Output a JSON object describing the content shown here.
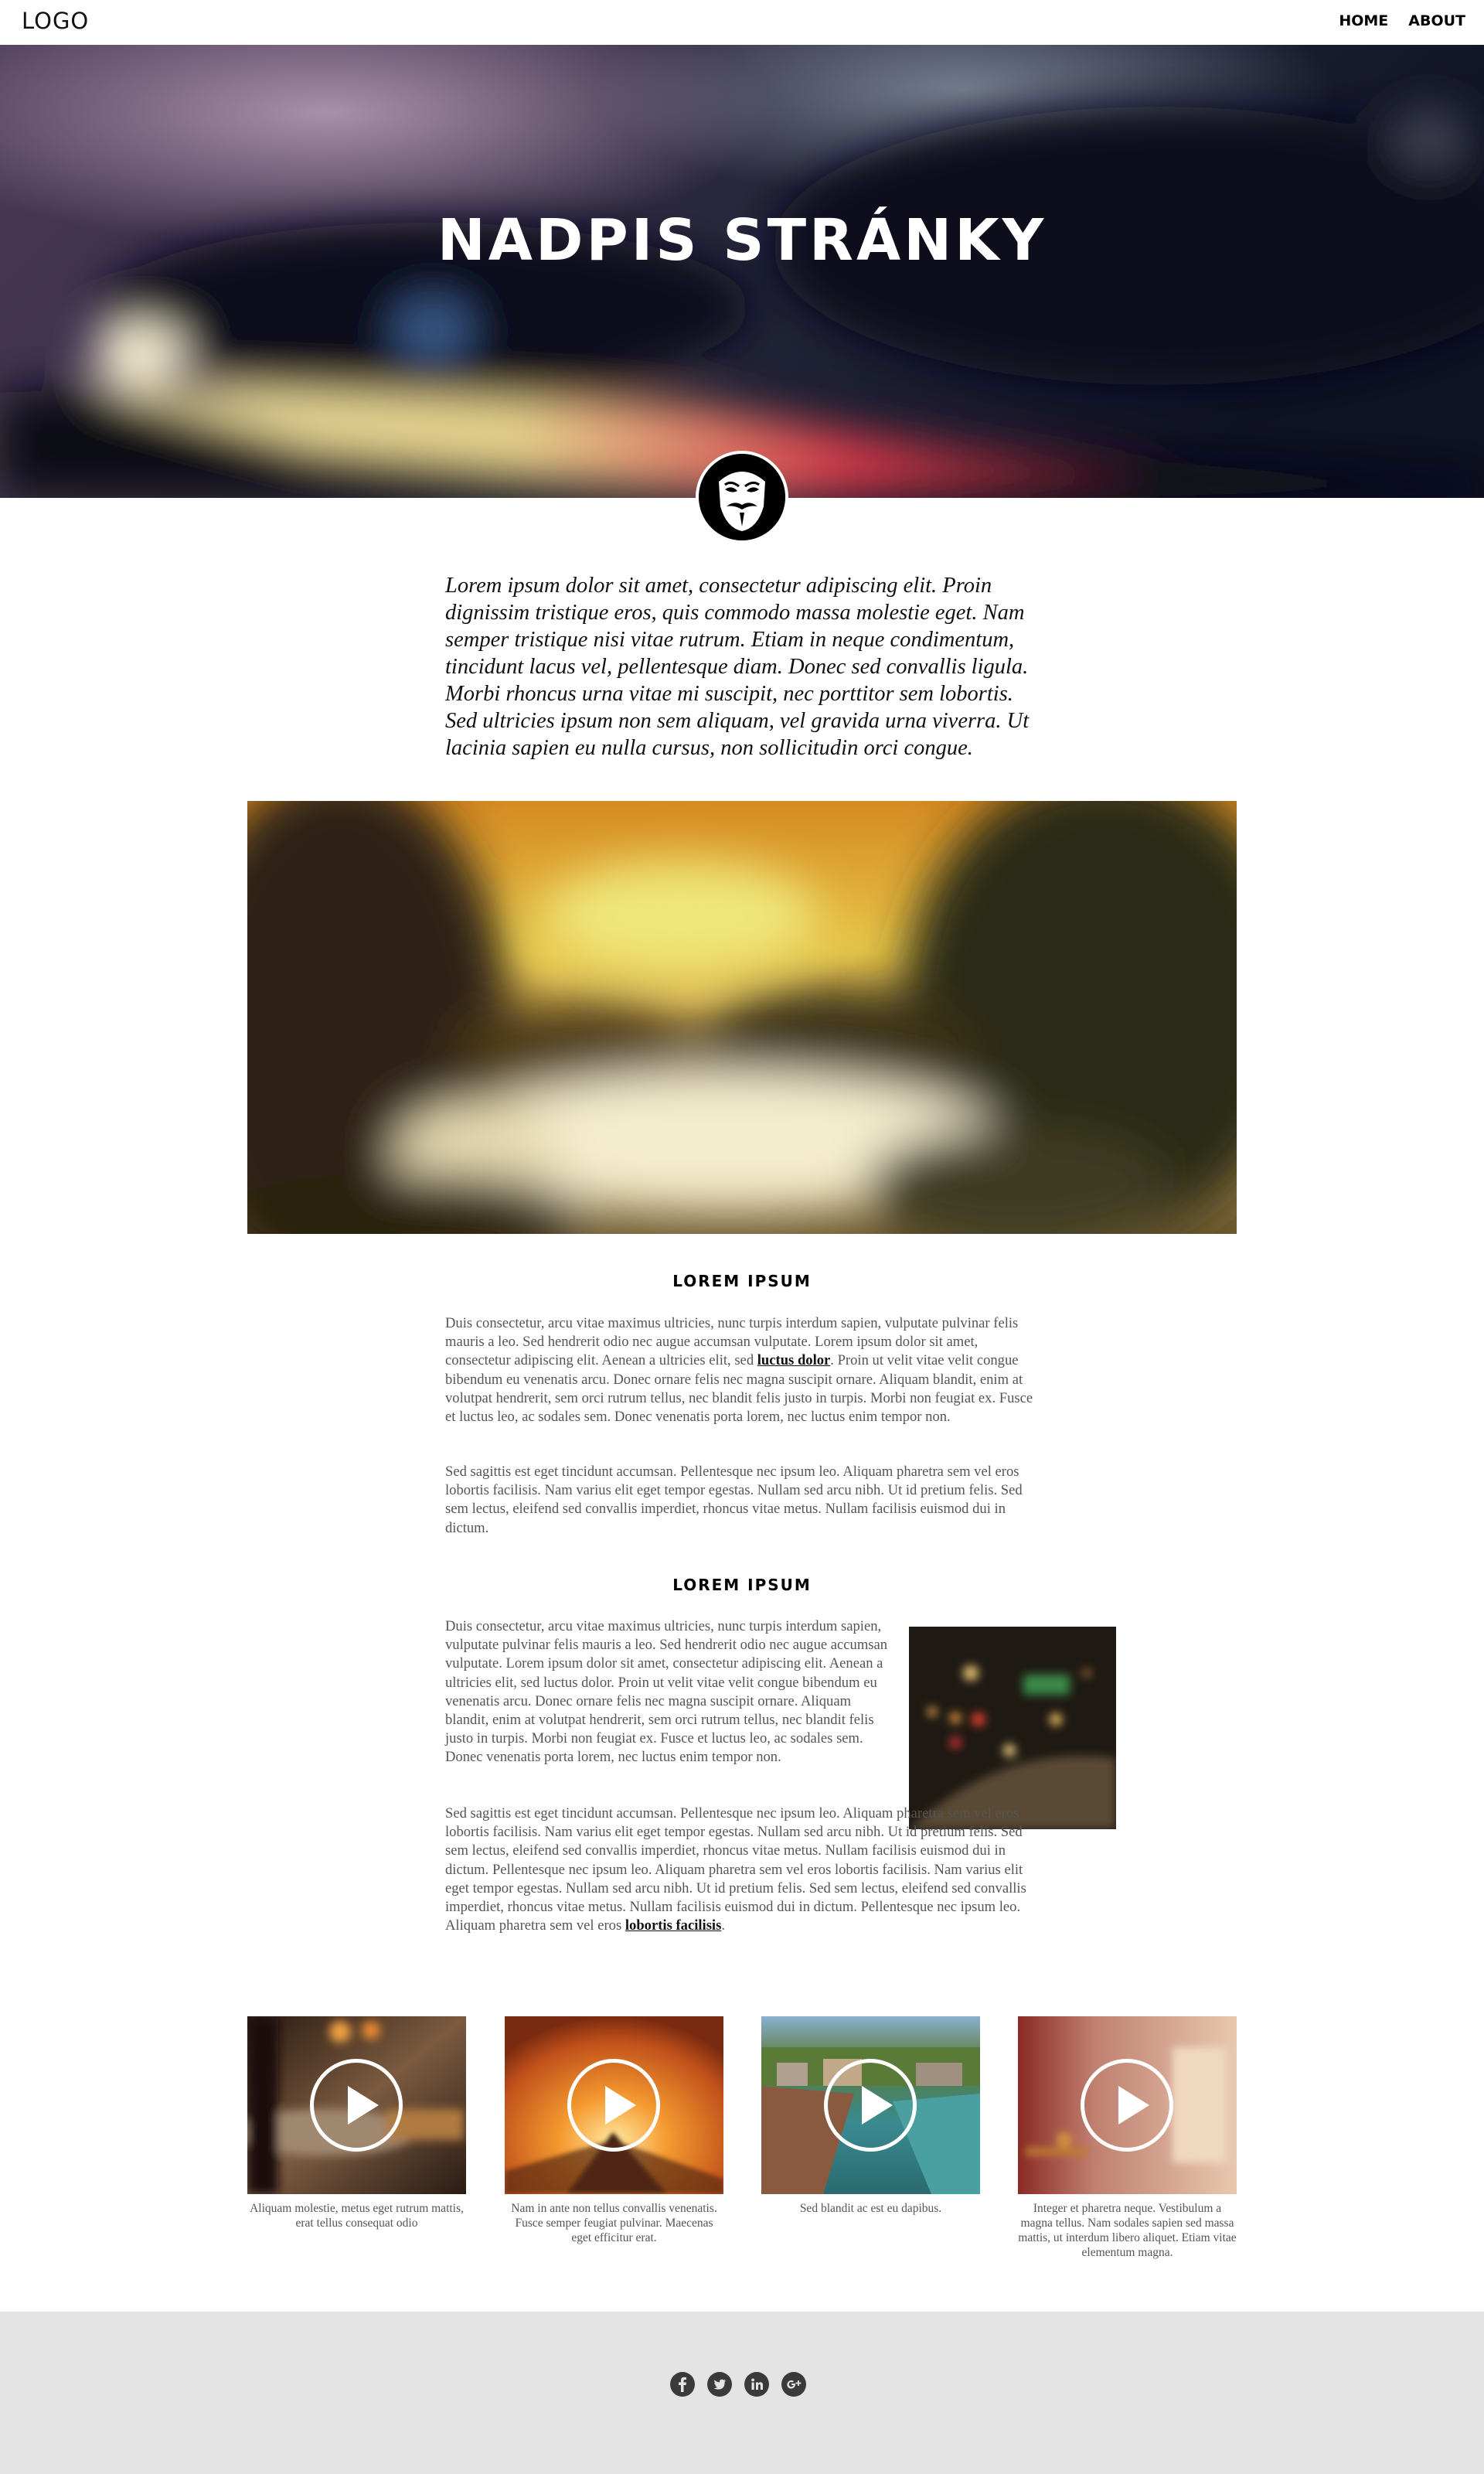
{
  "header": {
    "logo": "LOGO",
    "nav": [
      {
        "label": "HOME"
      },
      {
        "label": "ABOUT"
      }
    ]
  },
  "hero": {
    "title": "NADPIS STRÁNKY"
  },
  "intro": {
    "text": "Lorem ipsum dolor sit amet, consectetur adipiscing elit. Proin dignissim tristique eros, quis commodo massa molestie eget. Nam semper tristique nisi vitae rutrum. Etiam in neque condimentum, tincidunt lacus vel, pellentesque diam. Donec sed convallis ligula. Morbi rhoncus urna vitae mi suscipit, nec porttitor sem lobortis. Sed ultricies ipsum non sem aliquam, vel gravida urna viverra. Ut lacinia sapien eu nulla cursus, non sollicitudin orci congue."
  },
  "section1": {
    "title": "LOREM IPSUM",
    "p1_before": "Duis consectetur, arcu vitae maximus ultricies, nunc turpis interdum sapien, vulputate pulvinar felis mauris a leo. Sed hendrerit odio nec augue accumsan vulputate. Lorem ipsum dolor sit amet, consectetur adipiscing elit. Aenean a ultricies elit, sed ",
    "p1_link": "luctus dolor",
    "p1_after": ". Proin ut velit vitae velit congue bibendum eu venenatis arcu. Donec ornare felis nec magna suscipit ornare. Aliquam blandit, enim at volutpat hendrerit, sem orci rutrum tellus, nec blandit felis justo in turpis. Morbi non feugiat ex. Fusce et luctus leo, ac sodales sem. Donec venenatis porta lorem, nec luctus enim tempor non.",
    "p2": "Sed sagittis est eget tincidunt accumsan. Pellentesque nec ipsum leo. Aliquam pharetra sem vel eros lobortis facilisis. Nam varius elit eget tempor egestas. Nullam sed arcu nibh. Ut id pretium felis. Sed sem lectus, eleifend sed convallis imperdiet, rhoncus vitae metus. Nullam facilisis euismod dui in dictum."
  },
  "section2": {
    "title": "LOREM IPSUM",
    "p1": "Duis consectetur, arcu vitae maximus ultricies, nunc turpis interdum sapien, vulputate pulvinar felis mauris a leo. Sed hendrerit odio nec augue accumsan vulputate. Lorem ipsum dolor sit amet, consectetur adipiscing elit. Aenean a ultricies elit, sed luctus dolor. Proin ut velit vitae velit congue bibendum eu venenatis arcu. Donec ornare felis nec magna suscipit ornare. Aliquam blandit, enim at volutpat hendrerit, sem orci rutrum tellus, nec blandit felis justo in turpis. Morbi non feugiat ex. Fusce et luctus leo, ac sodales sem. Donec venenatis porta lorem, nec luctus enim tempor non.",
    "p2_before": "Sed sagittis est eget tincidunt accumsan. Pellentesque nec ipsum leo. Aliquam pharetra sem vel eros lobortis facilisis. Nam varius elit eget tempor egestas. Nullam sed arcu nibh. Ut id pretium felis. Sed sem lectus, eleifend sed convallis imperdiet, rhoncus vitae metus. Nullam facilisis euismod dui in dictum. Pellentesque nec ipsum leo. Aliquam pharetra sem vel eros lobortis facilisis. Nam varius elit eget tempor egestas. Nullam sed arcu nibh. Ut id pretium felis. Sed sem lectus, eleifend sed convallis imperdiet, rhoncus vitae metus. Nullam facilisis euismod dui in dictum. Pellentesque nec ipsum leo. Aliquam pharetra sem vel eros ",
    "p2_link": "lobortis facilisis",
    "p2_after": "."
  },
  "videos": [
    {
      "caption": "Aliquam molestie, metus eget rutrum mattis, erat tellus consequat odio"
    },
    {
      "caption": "Nam in ante non tellus convallis venenatis. Fusce semper feugiat pulvinar. Maecenas eget efficitur erat."
    },
    {
      "caption": "Sed blandit ac est eu dapibus."
    },
    {
      "caption": "Integer et pharetra neque. Vestibulum a magna tellus. Nam sodales sapien sed massa mattis, ut interdum libero aliquet. Etiam vitae elementum magna."
    }
  ],
  "footer": {
    "social": [
      "facebook-icon",
      "twitter-icon",
      "linkedin-icon",
      "google-plus-icon"
    ]
  }
}
